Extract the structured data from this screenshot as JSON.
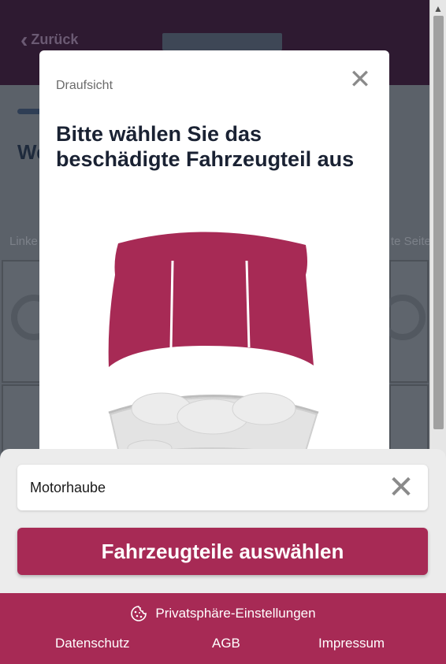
{
  "header": {
    "back_label": "Zurück"
  },
  "background": {
    "title_fragment": "We",
    "left_label": "Linke",
    "right_label": "te Seite"
  },
  "modal": {
    "subtitle": "Draufsicht",
    "title": "Bitte wählen Sie das beschädigte Fahrzeugteil aus",
    "close_icon": "close-icon"
  },
  "selection": {
    "selected_part": "Motorhaube",
    "clear_icon": "close-icon",
    "button_label": "Fahrzeugteile auswählen"
  },
  "footer": {
    "privacy_label": "Privatsphäre-Einstellungen",
    "links": [
      "Datenschutz",
      "AGB",
      "Impressum"
    ]
  },
  "colors": {
    "accent": "#a72a55",
    "header_dark": "#2e1a31",
    "title": "#1a2233"
  }
}
